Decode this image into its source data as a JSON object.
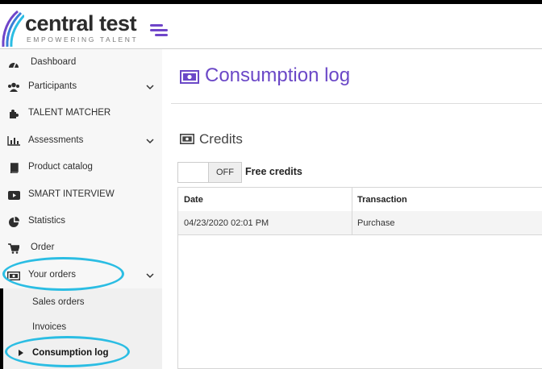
{
  "brand": {
    "name": "central test",
    "tagline": "EMPOWERING TALENT",
    "accent": "#6b48c7",
    "highlight_ring": "#2bbde3"
  },
  "sidebar": {
    "items": [
      {
        "label": "Dashboard",
        "icon": "dashboard-icon"
      },
      {
        "label": "Participants",
        "icon": "users-icon",
        "expandable": true
      },
      {
        "label": "TALENT MATCHER",
        "icon": "puzzle-icon"
      },
      {
        "label": "Assessments",
        "icon": "bar-chart-icon",
        "expandable": true
      },
      {
        "label": "Product catalog",
        "icon": "book-icon"
      },
      {
        "label": "SMART INTERVIEW",
        "icon": "video-icon"
      },
      {
        "label": "Statistics",
        "icon": "pie-chart-icon"
      },
      {
        "label": "Order",
        "icon": "cart-icon"
      },
      {
        "label": "Your orders",
        "icon": "money-icon",
        "expandable": true,
        "expanded": true
      }
    ],
    "submenu": [
      {
        "label": "Sales orders"
      },
      {
        "label": "Invoices"
      },
      {
        "label": "Consumption log",
        "active": true
      }
    ]
  },
  "main": {
    "title": "Consumption log",
    "section_title": "Credits",
    "toggle": {
      "state_label": "OFF",
      "label": "Free credits"
    },
    "table": {
      "columns": [
        "Date",
        "Transaction"
      ],
      "rows": [
        [
          "04/23/2020 02:01 PM",
          "Purchase"
        ]
      ]
    }
  }
}
